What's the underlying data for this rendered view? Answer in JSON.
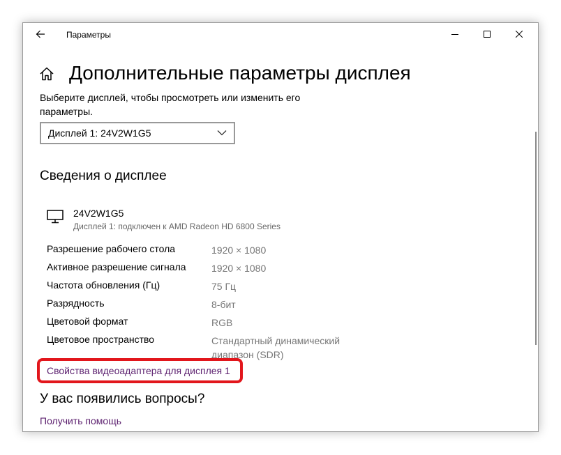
{
  "window": {
    "title": "Параметры"
  },
  "page": {
    "title": "Дополнительные параметры дисплея",
    "subtitle": "Выберите дисплей, чтобы просмотреть или изменить его параметры."
  },
  "display_select": {
    "value": "Дисплей 1: 24V2W1G5"
  },
  "display_info": {
    "section_title": "Сведения о дисплее",
    "monitor_name": "24V2W1G5",
    "monitor_desc": "Дисплей 1: подключен к AMD Radeon HD 6800 Series",
    "rows": [
      {
        "label": "Разрешение рабочего стола",
        "value": "1920 × 1080"
      },
      {
        "label": "Активное разрешение сигнала",
        "value": "1920 × 1080"
      },
      {
        "label": "Частота обновления (Гц)",
        "value": "75 Гц"
      },
      {
        "label": "Разрядность",
        "value": "8-бит"
      },
      {
        "label": "Цветовой формат",
        "value": "RGB"
      },
      {
        "label": "Цветовое пространство",
        "value": "Стандартный динамический диапазон (SDR)"
      }
    ],
    "adapter_link": "Свойства видеоадаптера для дисплея 1"
  },
  "questions": {
    "title": "У вас появились вопросы?",
    "help_link": "Получить помощь"
  },
  "icons": {
    "back": "arrow-left-icon",
    "home": "home-icon",
    "monitor": "monitor-icon",
    "chevron": "chevron-down-icon"
  },
  "colors": {
    "link": "#5b1f6e",
    "highlight": "#e2161c",
    "secondary_text": "#767676"
  }
}
